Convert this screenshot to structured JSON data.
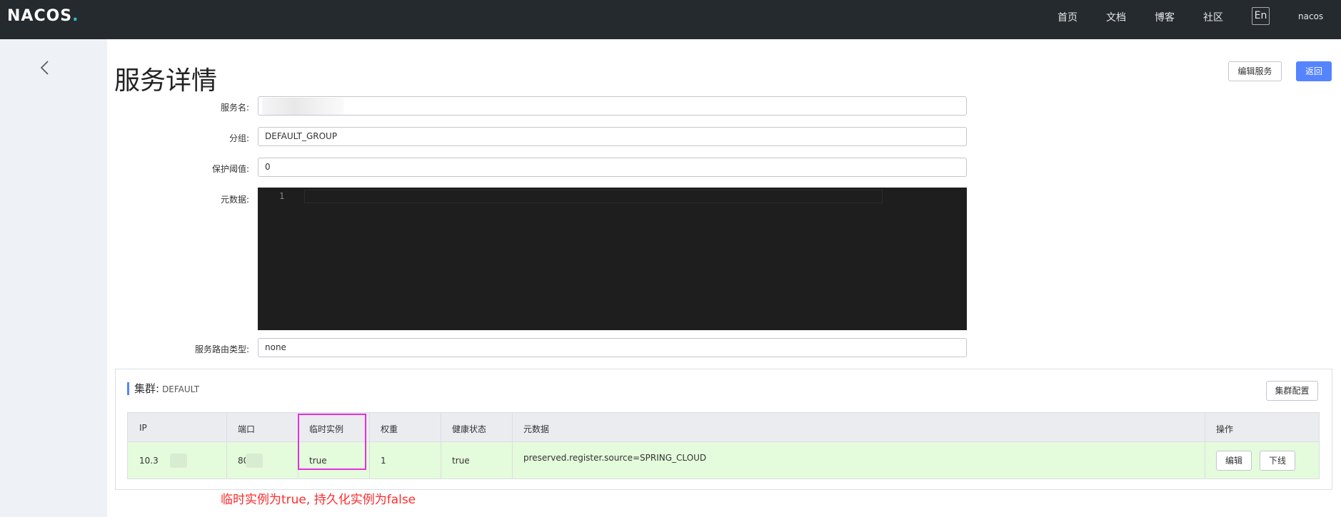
{
  "header": {
    "logo": "NACOS",
    "logo_dot": ".",
    "nav": [
      "首页",
      "文档",
      "博客",
      "社区"
    ],
    "lang_button": "En",
    "user": "nacos"
  },
  "page": {
    "title": "服务详情",
    "edit_service_button": "编辑服务",
    "back_button": "返回"
  },
  "form": {
    "service_name_label": "服务名:",
    "service_name_value": "",
    "group_label": "分组:",
    "group_value": "DEFAULT_GROUP",
    "protect_threshold_label": "保护阈值:",
    "protect_threshold_value": "0",
    "metadata_label": "元数据:",
    "metadata_line_number": "1",
    "selector_type_label": "服务路由类型:",
    "selector_type_value": "none"
  },
  "cluster": {
    "title": "集群:",
    "name": "DEFAULT",
    "config_button": "集群配置",
    "columns": [
      "IP",
      "端口",
      "临时实例",
      "权重",
      "健康状态",
      "元数据",
      "操作"
    ],
    "rows": [
      {
        "ip": "10.3",
        "port": "80",
        "ephemeral": "true",
        "weight": "1",
        "healthy": "true",
        "metadata": "preserved.register.source=SPRING_CLOUD",
        "edit_button": "编辑",
        "offline_button": "下线"
      }
    ]
  },
  "annotation": "临时实例为true, 持久化实例为false"
}
